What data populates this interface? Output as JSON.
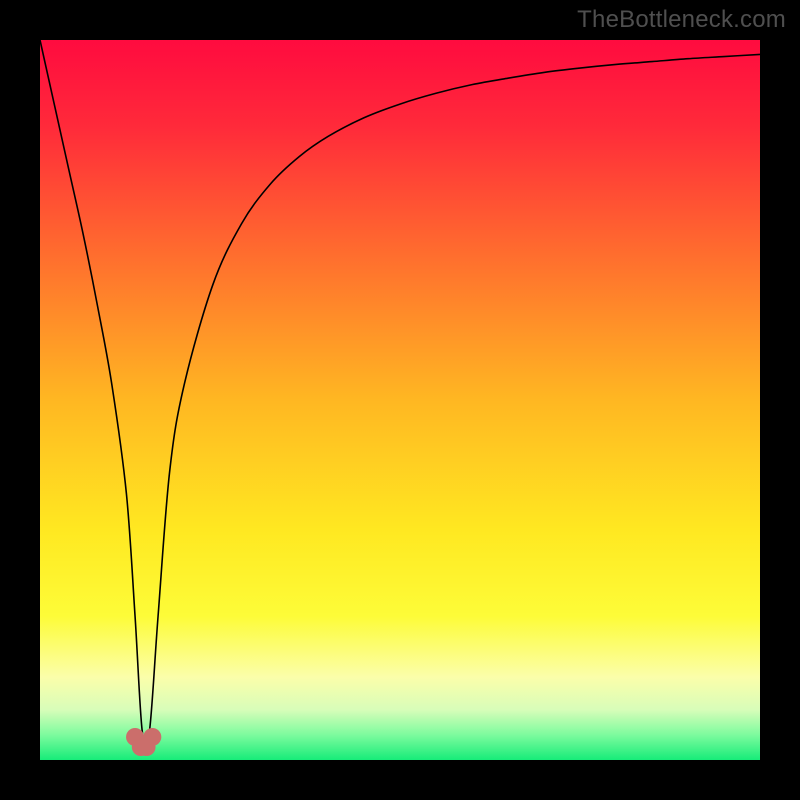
{
  "watermark": "TheBottleneck.com",
  "chart_data": {
    "type": "line",
    "title": "",
    "xlabel": "",
    "ylabel": "",
    "xlim": [
      0,
      100
    ],
    "ylim": [
      0,
      100
    ],
    "grid": false,
    "background": {
      "type": "vertical-gradient",
      "stops": [
        {
          "pos": 0.0,
          "color": "#ff0b3f"
        },
        {
          "pos": 0.12,
          "color": "#ff2a3a"
        },
        {
          "pos": 0.3,
          "color": "#ff6e2e"
        },
        {
          "pos": 0.5,
          "color": "#ffb722"
        },
        {
          "pos": 0.68,
          "color": "#ffe821"
        },
        {
          "pos": 0.8,
          "color": "#fdfc38"
        },
        {
          "pos": 0.885,
          "color": "#fbfeaa"
        },
        {
          "pos": 0.93,
          "color": "#d8fdb9"
        },
        {
          "pos": 0.965,
          "color": "#7dfb9e"
        },
        {
          "pos": 1.0,
          "color": "#17ec79"
        }
      ]
    },
    "annotations": [],
    "series": [
      {
        "name": "bottleneck-curve",
        "color": "#000000",
        "width": 1.6,
        "x": [
          0,
          2,
          4,
          6,
          8,
          10,
          12,
          13.2,
          14.2,
          15.2,
          16.4,
          18,
          20,
          24,
          28,
          32,
          36,
          40,
          45,
          50,
          55,
          60,
          65,
          70,
          75,
          80,
          85,
          90,
          95,
          100
        ],
        "y": [
          100,
          91,
          82,
          73,
          63,
          52,
          37,
          20,
          4,
          4,
          20,
          40,
          52,
          66,
          74.5,
          80,
          83.8,
          86.6,
          89.2,
          91.1,
          92.6,
          93.8,
          94.7,
          95.5,
          96.1,
          96.6,
          97.0,
          97.4,
          97.7,
          98.0
        ]
      }
    ],
    "markers": {
      "name": "valley-markers",
      "color": "#cb6e6b",
      "radius": 9,
      "points": [
        {
          "x": 13.2,
          "y": 3.2
        },
        {
          "x": 14.0,
          "y": 1.8
        },
        {
          "x": 14.8,
          "y": 1.8
        },
        {
          "x": 15.6,
          "y": 3.2
        }
      ]
    }
  }
}
